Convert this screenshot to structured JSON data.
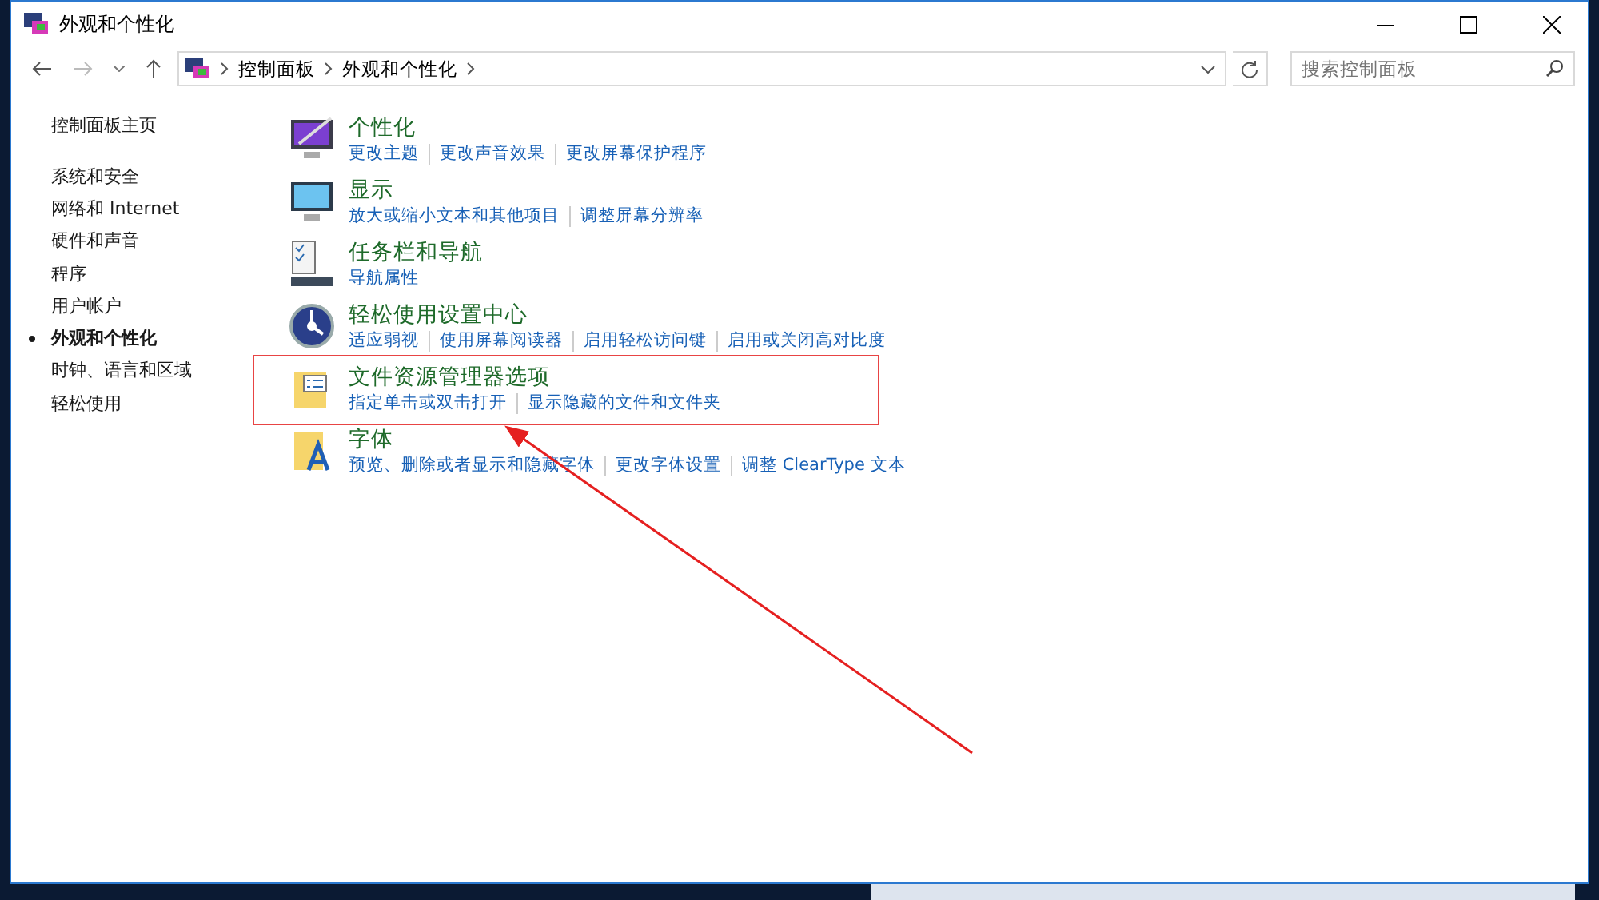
{
  "window": {
    "title": "外观和个性化"
  },
  "address_bar": {
    "path": [
      "控制面板",
      "外观和个性化"
    ]
  },
  "search": {
    "placeholder": "搜索控制面板"
  },
  "sidebar": {
    "home": "控制面板主页",
    "items": [
      {
        "label": "系统和安全",
        "selected": false
      },
      {
        "label": "网络和 Internet",
        "selected": false
      },
      {
        "label": "硬件和声音",
        "selected": false
      },
      {
        "label": "程序",
        "selected": false
      },
      {
        "label": "用户帐户",
        "selected": false
      },
      {
        "label": "外观和个性化",
        "selected": true
      },
      {
        "label": "时钟、语言和区域",
        "selected": false
      },
      {
        "label": "轻松使用",
        "selected": false
      }
    ]
  },
  "categories": [
    {
      "kind": "personalization",
      "title": "个性化",
      "links": [
        "更改主题",
        "更改声音效果",
        "更改屏幕保护程序"
      ],
      "highlighted": false
    },
    {
      "kind": "display",
      "title": "显示",
      "links": [
        "放大或缩小文本和其他项目",
        "调整屏幕分辨率"
      ],
      "highlighted": false
    },
    {
      "kind": "taskbar",
      "title": "任务栏和导航",
      "links": [
        "导航属性"
      ],
      "highlighted": false
    },
    {
      "kind": "ease",
      "title": "轻松使用设置中心",
      "links": [
        "适应弱视",
        "使用屏幕阅读器",
        "启用轻松访问键",
        "启用或关闭高对比度"
      ],
      "highlighted": false
    },
    {
      "kind": "folder",
      "title": "文件资源管理器选项",
      "links": [
        "指定单击或双击打开",
        "显示隐藏的文件和文件夹"
      ],
      "highlighted": true
    },
    {
      "kind": "fonts",
      "title": "字体",
      "links": [
        "预览、删除或者显示和隐藏字体",
        "更改字体设置",
        "调整 ClearType 文本"
      ],
      "highlighted": false
    }
  ]
}
